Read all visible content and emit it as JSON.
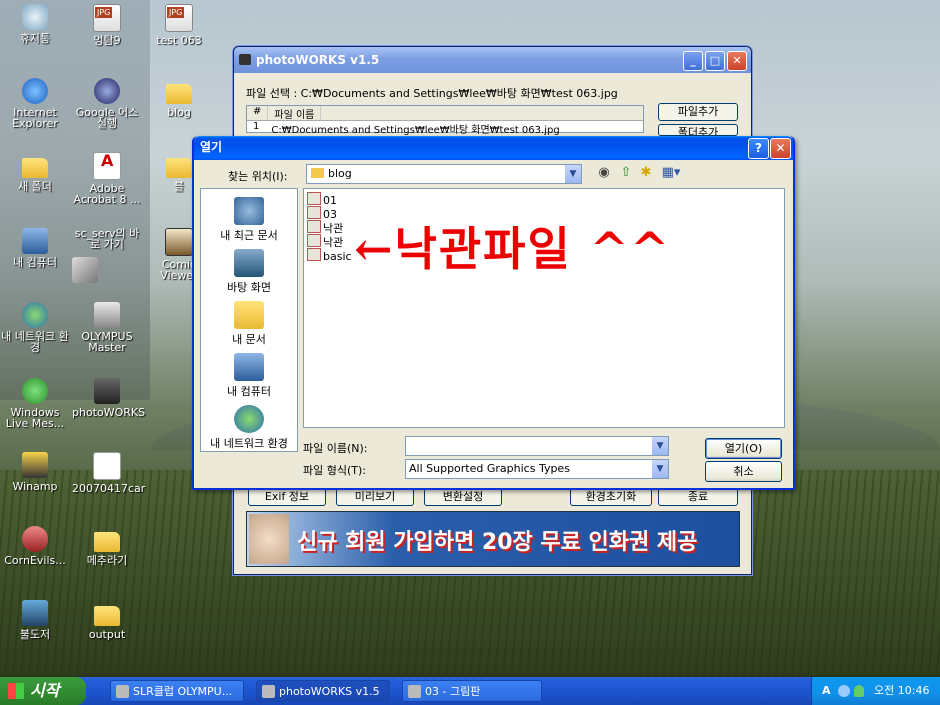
{
  "desktop_icons": [
    {
      "label": "휴지통",
      "icon": "recycle-bin-icon"
    },
    {
      "label": "멍탐9",
      "icon": "jpg-file-icon"
    },
    {
      "label": "test 063",
      "icon": "jpg-file-icon"
    },
    {
      "label": "Internet Explorer",
      "icon": "internet-explorer-icon"
    },
    {
      "label": "Google 어스 실행",
      "icon": "google-earth-icon"
    },
    {
      "label": "blog",
      "icon": "folder-icon"
    },
    {
      "label": "새 폴더",
      "icon": "folder-icon"
    },
    {
      "label": "Adobe Acrobat 8 ...",
      "icon": "pdf-icon"
    },
    {
      "label": "블",
      "icon": "folder-icon"
    },
    {
      "label": "내 컴퓨터",
      "icon": "computer-icon"
    },
    {
      "label": "sc_serv의 바로 가기",
      "icon": "shortcut-icon"
    },
    {
      "label": "Comic Viewer",
      "icon": "comic-viewer-icon"
    },
    {
      "label": "내 네트워크 환경",
      "icon": "network-icon"
    },
    {
      "label": "OLYMPUS Master",
      "icon": "olympus-icon"
    },
    {
      "label": "Windows Live Mes...",
      "icon": "messenger-icon"
    },
    {
      "label": "photoWORKS",
      "icon": "camera-icon"
    },
    {
      "label": "Winamp",
      "icon": "winamp-icon"
    },
    {
      "label": "20070417car",
      "icon": "document-icon"
    },
    {
      "label": "CornEvils...",
      "icon": "wmv-icon"
    },
    {
      "label": "메추라기",
      "icon": "folder-icon"
    },
    {
      "label": "불도저",
      "icon": "shortcut-icon"
    },
    {
      "label": "output",
      "icon": "folder-icon"
    }
  ],
  "photoworks": {
    "title": "photoWORKS v1.5",
    "file_select_label": "파일 선택 : C:₩Documents and Settings₩lee₩바탕 화면₩test 063.jpg",
    "columns": [
      "#",
      "파일 이름"
    ],
    "rows": [
      {
        "num": "1",
        "name": "C:₩Documents and Settings₩lee₩바탕 화면₩test 063.jpg"
      }
    ],
    "add_file_button": "파일추가",
    "add_folder_button": "폴더추가",
    "exif_button": "Exif 정보",
    "preview_button": "미리보기",
    "convert_button": "변환설정",
    "reset_button": "환경초기화",
    "exit_button": "종료",
    "banner_text": "신규 회원 가입하면 20장 무료 인화권 제공"
  },
  "open_dialog": {
    "title": "열기",
    "look_in_label": "찾는 위치(I):",
    "look_in_value": "blog",
    "places": [
      "내 최근 문서",
      "바탕 화면",
      "내 문서",
      "내 컴퓨터",
      "내 네트워크 환경"
    ],
    "files": [
      "01",
      "03",
      "낙관",
      "낙관",
      "basic"
    ],
    "annotation": "←낙관파일 ^^",
    "filename_label": "파일 이름(N):",
    "filename_value": "",
    "filetype_label": "파일 형식(T):",
    "filetype_value": "All Supported Graphics Types",
    "open_button": "열기(O)",
    "cancel_button": "취소"
  },
  "taskbar": {
    "start_label": "시작",
    "tasks": [
      "SLR클럽 OLYMPU...",
      "photoWORKS v1.5",
      "03 - 그림판"
    ],
    "tray_lang": "A",
    "clock": "오전 10:46"
  }
}
